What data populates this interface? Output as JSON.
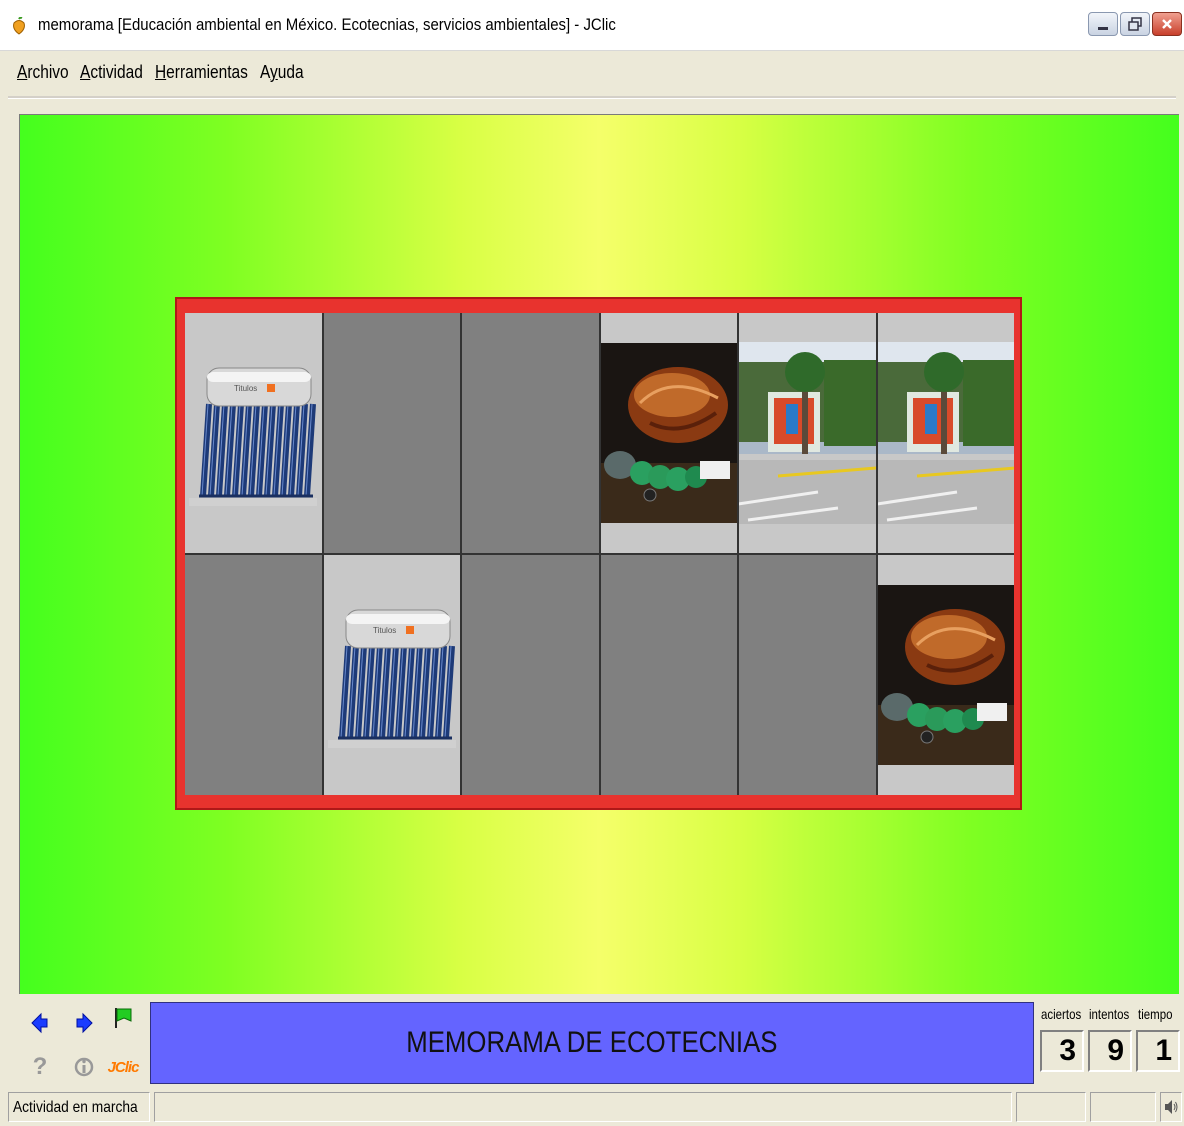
{
  "window": {
    "title": "memorama [Educación ambiental en México. Ecotecnias, servicios ambientales] - JClic",
    "buttons": {
      "minimize": "minimize-icon",
      "maximize": "restore-icon",
      "close": "close-icon"
    }
  },
  "menu": {
    "items": [
      {
        "label": "Archivo",
        "accel": "A"
      },
      {
        "label": "Actividad",
        "accel": "A"
      },
      {
        "label": "Herramientas",
        "accel": "H"
      },
      {
        "label": "Ayuda",
        "accel": "y"
      }
    ]
  },
  "colors": {
    "stage_edge": "#44ff1e",
    "stage_center": "#f5ff6a",
    "board_border": "#e8332e",
    "card_back": "#808080",
    "message_bg": "#6464ff",
    "nav_arrow": "#1a3cff",
    "flag": "#22cc22",
    "jclic_logo": "#ff7a00"
  },
  "board": {
    "rows": 2,
    "cols": 6,
    "cards": [
      {
        "state": "up",
        "image": "solar-water-heater"
      },
      {
        "state": "down",
        "image": ""
      },
      {
        "state": "down",
        "image": ""
      },
      {
        "state": "up",
        "image": "recycled-bottle-sculpture"
      },
      {
        "state": "up",
        "image": "green-wall-street"
      },
      {
        "state": "up",
        "image": "green-wall-street"
      },
      {
        "state": "down",
        "image": ""
      },
      {
        "state": "up",
        "image": "solar-water-heater"
      },
      {
        "state": "down",
        "image": ""
      },
      {
        "state": "down",
        "image": ""
      },
      {
        "state": "down",
        "image": ""
      },
      {
        "state": "up",
        "image": "recycled-bottle-sculpture"
      }
    ],
    "heater_brand": "Titulos"
  },
  "bottom": {
    "nav_icons": [
      "prev-arrow-icon",
      "next-arrow-icon",
      "flag-icon",
      "help-icon",
      "info-icon",
      "jclic-logo"
    ],
    "jclic_label": "JClic",
    "message": "MEMORAMA DE ECOTECNIAS",
    "counters": {
      "aciertos_label": "aciertos",
      "intentos_label": "intentos",
      "tiempo_label": "tiempo",
      "aciertos": "3",
      "intentos": "9",
      "tiempo": "1"
    }
  },
  "status": {
    "text": "Actividad en marcha",
    "sound_icon": "speaker-icon"
  }
}
